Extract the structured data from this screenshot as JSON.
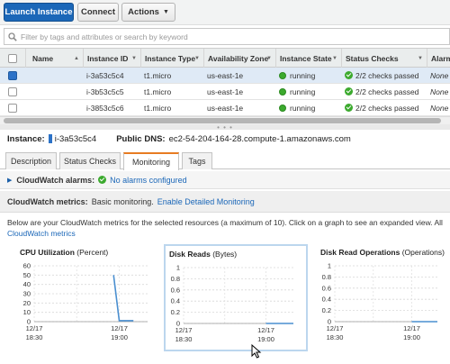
{
  "toolbar": {
    "launch_label": "Launch Instance",
    "connect_label": "Connect",
    "actions_label": "Actions"
  },
  "filter": {
    "placeholder": "Filter by tags and attributes or search by keyword"
  },
  "table": {
    "columns": [
      "Name",
      "Instance ID",
      "Instance Type",
      "Availability Zone",
      "Instance State",
      "Status Checks",
      "Alarm"
    ],
    "rows": [
      {
        "name": "",
        "id": "i-3a53c5c4",
        "type": "t1.micro",
        "az": "us-east-1e",
        "state": "running",
        "checks": "2/2 checks passed",
        "alarm": "None",
        "selected": true
      },
      {
        "name": "",
        "id": "i-3b53c5c5",
        "type": "t1.micro",
        "az": "us-east-1e",
        "state": "running",
        "checks": "2/2 checks passed",
        "alarm": "None",
        "selected": false
      },
      {
        "name": "",
        "id": "i-3853c5c6",
        "type": "t1.micro",
        "az": "us-east-1e",
        "state": "running",
        "checks": "2/2 checks passed",
        "alarm": "None",
        "selected": false
      }
    ]
  },
  "detail": {
    "instance_label": "Instance:",
    "instance_id": "i-3a53c5c4",
    "dns_label": "Public DNS:",
    "dns_value": "ec2-54-204-164-28.compute-1.amazonaws.com"
  },
  "tabs": [
    {
      "label": "Description",
      "active": false
    },
    {
      "label": "Status Checks",
      "active": false
    },
    {
      "label": "Monitoring",
      "active": true
    },
    {
      "label": "Tags",
      "active": false
    }
  ],
  "alarms": {
    "label": "CloudWatch alarms:",
    "value": "No alarms configured"
  },
  "metrics": {
    "label": "CloudWatch metrics:",
    "value": "Basic monitoring.",
    "link": "Enable Detailed Monitoring"
  },
  "note": {
    "text": "Below are your CloudWatch metrics for the selected resources (a maximum of 10). Click on a graph to see an expanded view. All",
    "link": "CloudWatch metrics"
  },
  "colors": {
    "accent": "#1b67b8",
    "running": "#3caa2e",
    "tab_active": "#e77c22",
    "series": "#4a8fd0"
  },
  "chart_data": [
    {
      "type": "line",
      "title": "CPU Utilization",
      "unit": "(Percent)",
      "ylim": [
        0,
        60
      ],
      "yticks": [
        0,
        10,
        20,
        30,
        40,
        50,
        60
      ],
      "xticks": [
        "12/17 18:30",
        "12/17 19:00"
      ],
      "series": [
        {
          "x": [
            "12/17 18:58",
            "12/17 19:00",
            "12/17 19:05"
          ],
          "values": [
            50,
            1,
            1
          ]
        }
      ],
      "grid": true
    },
    {
      "type": "line",
      "title": "Disk Reads",
      "unit": "(Bytes)",
      "ylim": [
        0,
        1
      ],
      "yticks": [
        0,
        0.2,
        0.4,
        0.6,
        0.8,
        1
      ],
      "xticks": [
        "12/17 18:30",
        "12/17 19:00"
      ],
      "series": [
        {
          "x": [
            "12/17 19:00",
            "12/17 19:10"
          ],
          "values": [
            0,
            0
          ]
        }
      ],
      "grid": true,
      "highlighted": true
    },
    {
      "type": "line",
      "title": "Disk Read Operations",
      "unit": "(Operations)",
      "ylim": [
        0,
        1
      ],
      "yticks": [
        0,
        0.2,
        0.4,
        0.6,
        0.8,
        1
      ],
      "xticks": [
        "12/17 18:30",
        "12/17 19:00"
      ],
      "series": [
        {
          "x": [
            "12/17 19:00",
            "12/17 19:10"
          ],
          "values": [
            0,
            0
          ]
        }
      ],
      "grid": true
    }
  ]
}
